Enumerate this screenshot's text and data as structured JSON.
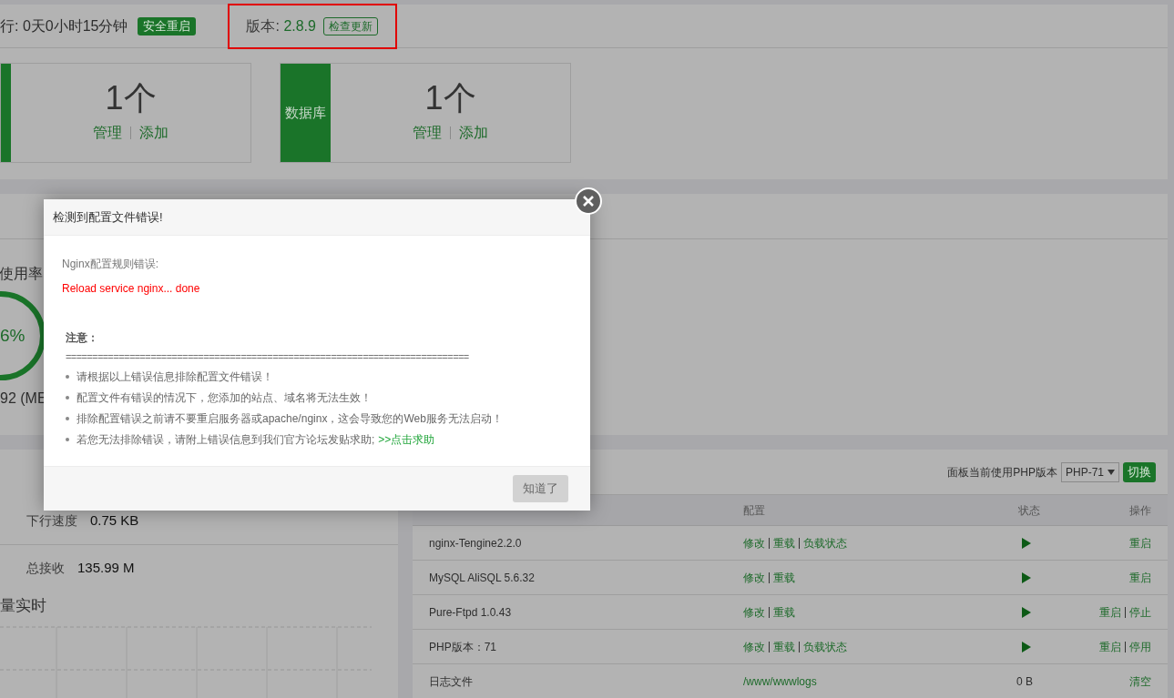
{
  "top_bar": {
    "uptime": "行: 0天0小时15分钟",
    "restart_button": "安全重启",
    "version_label": "版本:",
    "version": "2.8.9",
    "update_button": "检查更新"
  },
  "cards": [
    {
      "count": "1个",
      "links": [
        "管理",
        "添加"
      ]
    },
    {
      "label": "数据库",
      "count": "1个",
      "links": [
        "管理",
        "添加"
      ]
    }
  ],
  "memory": {
    "title": "使用率",
    "percent": "6%",
    "reading": "92 (ME"
  },
  "network": {
    "rows": [
      {
        "label": "下行速度",
        "value": "0.75 KB"
      },
      {
        "label": "总接收",
        "value": "135.99 M"
      }
    ],
    "chart_title": "量实时"
  },
  "software": {
    "php_label": "面板当前使用PHP版本",
    "php_select": "PHP-71",
    "switch_button": "切换",
    "columns": [
      "配置",
      "状态",
      "操作"
    ],
    "rows": [
      {
        "name": "nginx-Tengine2.2.0",
        "config": [
          "修改",
          "重载",
          "负载状态"
        ],
        "kind": "service",
        "actions": [
          "重启"
        ]
      },
      {
        "name": "MySQL AliSQL 5.6.32",
        "config": [
          "修改",
          "重载"
        ],
        "kind": "service",
        "actions": [
          "重启"
        ]
      },
      {
        "name": "Pure-Ftpd 1.0.43",
        "config": [
          "修改",
          "重载"
        ],
        "kind": "service",
        "actions": [
          "重启",
          "停止"
        ]
      },
      {
        "name": "PHP版本：71",
        "config": [
          "修改",
          "重载",
          "负载状态"
        ],
        "kind": "service",
        "actions": [
          "重启",
          "停用"
        ]
      },
      {
        "name": "日志文件",
        "config": [
          "/www/wwwlogs"
        ],
        "kind": "log",
        "status_text": "0 B",
        "actions": [
          "清空"
        ]
      }
    ]
  },
  "dialog": {
    "title": "检测到配置文件错误!",
    "error_label": "Nginx配置规则错误:",
    "error_message": "Reload service nginx... done",
    "note_title": "注意：",
    "separator": "============================================================================",
    "items": [
      {
        "text": "请根据以上错误信息排除配置文件错误！"
      },
      {
        "text": "配置文件有错误的情况下，您添加的站点、域名将无法生效！"
      },
      {
        "text": "排除配置错误之前请不要重启服务器或apache/nginx，这会导致您的Web服务无法启动！"
      },
      {
        "text": "若您无法排除错误，请附上错误信息到我们官方论坛发贴求助;",
        "link": ">>点击求助"
      }
    ],
    "ok_button": {
      "label": "知道了",
      "disabled": true
    }
  }
}
